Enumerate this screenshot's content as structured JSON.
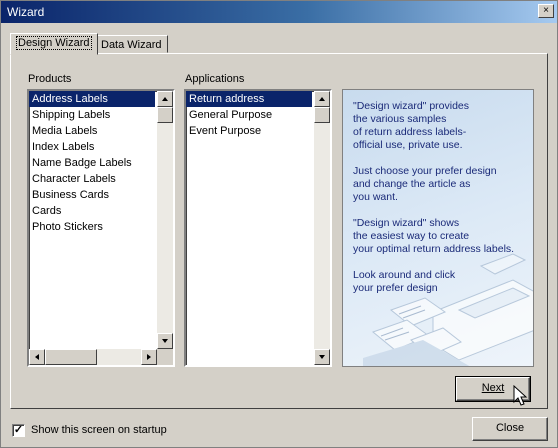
{
  "window": {
    "title": "Wizard",
    "close_glyph": "×"
  },
  "tabs": [
    {
      "label": "Design Wizard",
      "active": true
    },
    {
      "label": "Data Wizard",
      "active": false
    }
  ],
  "products": {
    "label": "Products",
    "items": [
      "Address Labels",
      "Shipping Labels",
      "Media Labels",
      "Index Labels",
      "Name Badge Labels",
      "Character Labels",
      "Business Cards",
      "Cards",
      "Photo Stickers"
    ],
    "selected_index": 0
  },
  "applications": {
    "label": "Applications",
    "items": [
      "Return address",
      "General Purpose",
      "Event Purpose"
    ],
    "selected_index": 0
  },
  "info": {
    "paragraphs": [
      "\"Design wizard\" provides\nthe various samples\nof return address labels-\nofficial use, private use.",
      "Just choose your prefer design\nand change the article as\nyou want.",
      "\"Design wizard\" shows\nthe easiest way to create\nyour optimal return address labels.",
      "Look around and click\nyour prefer design"
    ]
  },
  "buttons": {
    "next_label": "Next",
    "close_label": "Close"
  },
  "startup": {
    "label": "Show this screen on startup",
    "checked": true,
    "check_glyph": "✓"
  },
  "icons": [
    "close-icon",
    "scroll-up-icon",
    "scroll-down-icon",
    "scroll-left-icon",
    "scroll-right-icon",
    "checkmark-icon",
    "mouse-pointer-icon"
  ],
  "colors": {
    "selection": "#0a246a",
    "title_start": "#0a246a",
    "title_end": "#a6caf0",
    "info_text": "#1a2a78"
  }
}
